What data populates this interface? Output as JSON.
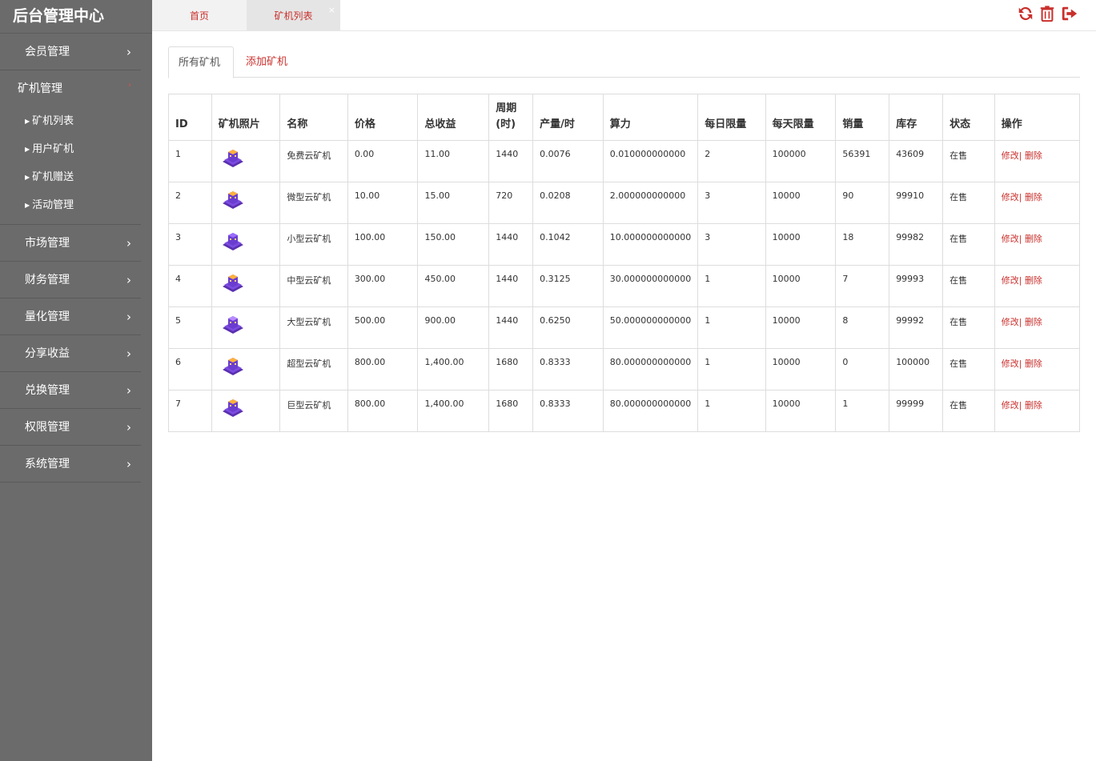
{
  "app": {
    "title": "后台管理中心"
  },
  "sidebar": {
    "items": [
      {
        "label": "会员管理"
      },
      {
        "label": "矿机管理",
        "open": true,
        "children": [
          {
            "label": "矿机列表"
          },
          {
            "label": "用户矿机"
          },
          {
            "label": "矿机赠送"
          },
          {
            "label": "活动管理"
          }
        ]
      },
      {
        "label": "市场管理"
      },
      {
        "label": "财务管理"
      },
      {
        "label": "量化管理"
      },
      {
        "label": "分享收益"
      },
      {
        "label": "兑换管理"
      },
      {
        "label": "权限管理"
      },
      {
        "label": "系统管理"
      }
    ]
  },
  "tabs": {
    "home": "首页",
    "active": "矿机列表",
    "close": "×"
  },
  "toolbar": {
    "icons": [
      "refresh-icon",
      "trash-icon",
      "sign-out-icon"
    ],
    "accent": "#c9302c"
  },
  "subtabs": {
    "all": "所有矿机",
    "add": "添加矿机"
  },
  "table": {
    "headers": [
      "ID",
      "矿机照片",
      "名称",
      "价格",
      "总收益",
      "周期(时)",
      "产量/时",
      "算力",
      "每日限量",
      "每天限量",
      "销量",
      "库存",
      "状态",
      "操作"
    ],
    "header_cycle_line1": "周期",
    "header_cycle_line2": "(时)",
    "action_edit": "修改|",
    "action_delete": "删除",
    "rows": [
      {
        "id": "1",
        "name": "免费云矿机",
        "price": "0.00",
        "income": "11.00",
        "cycle": "1440",
        "output": "0.0076",
        "power": "0.010000000000",
        "daily": "2",
        "day_limit": "100000",
        "sold": "56391",
        "stock": "43609",
        "status": "在售"
      },
      {
        "id": "2",
        "name": "微型云矿机",
        "price": "10.00",
        "income": "15.00",
        "cycle": "720",
        "output": "0.0208",
        "power": "2.000000000000",
        "daily": "3",
        "day_limit": "10000",
        "sold": "90",
        "stock": "99910",
        "status": "在售"
      },
      {
        "id": "3",
        "name": "小型云矿机",
        "price": "100.00",
        "income": "150.00",
        "cycle": "1440",
        "output": "0.1042",
        "power": "10.000000000000",
        "daily": "3",
        "day_limit": "10000",
        "sold": "18",
        "stock": "99982",
        "status": "在售"
      },
      {
        "id": "4",
        "name": "中型云矿机",
        "price": "300.00",
        "income": "450.00",
        "cycle": "1440",
        "output": "0.3125",
        "power": "30.000000000000",
        "daily": "1",
        "day_limit": "10000",
        "sold": "7",
        "stock": "99993",
        "status": "在售"
      },
      {
        "id": "5",
        "name": "大型云矿机",
        "price": "500.00",
        "income": "900.00",
        "cycle": "1440",
        "output": "0.6250",
        "power": "50.000000000000",
        "daily": "1",
        "day_limit": "10000",
        "sold": "8",
        "stock": "99992",
        "status": "在售"
      },
      {
        "id": "6",
        "name": "超型云矿机",
        "price": "800.00",
        "income": "1,400.00",
        "cycle": "1680",
        "output": "0.8333",
        "power": "80.000000000000",
        "daily": "1",
        "day_limit": "10000",
        "sold": "0",
        "stock": "100000",
        "status": "在售"
      },
      {
        "id": "7",
        "name": "巨型云矿机",
        "price": "800.00",
        "income": "1,400.00",
        "cycle": "1680",
        "output": "0.8333",
        "power": "80.000000000000",
        "daily": "1",
        "day_limit": "10000",
        "sold": "1",
        "stock": "99999",
        "status": "在售"
      }
    ]
  }
}
